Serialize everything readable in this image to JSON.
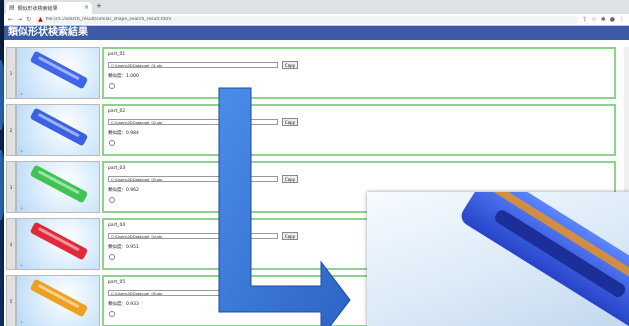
{
  "browser": {
    "tab_title": "類似形状検索結果",
    "new_tab_symbol": "+",
    "address_text": "file:///C:/search_result/similar_shape_search_result.html",
    "warning_icon": "warning-icon"
  },
  "header": {
    "title": "類似形状検索結果"
  },
  "results": [
    {
      "index": "1",
      "name": "part_01",
      "path": "C:\\Users\\3DData\\part_01.stp",
      "copy_label": "Copy",
      "similarity": "類似度：1.000",
      "color": "#3f66e8"
    },
    {
      "index": "2",
      "name": "part_02",
      "path": "C:\\Users\\3DData\\part_02.stp",
      "copy_label": "Copy",
      "similarity": "類似度：0.984",
      "color": "#3b61e2"
    },
    {
      "index": "3",
      "name": "part_03",
      "path": "C:\\Users\\3DData\\part_03.stp",
      "copy_label": "Copy",
      "similarity": "類似度：0.962",
      "color": "#3fc454"
    },
    {
      "index": "4",
      "name": "part_04",
      "path": "C:\\Users\\3DData\\part_04.stp",
      "copy_label": "Copy",
      "similarity": "類似度：0.951",
      "color": "#e02a3a"
    },
    {
      "index": "5",
      "name": "part_05",
      "path": "C:\\Users\\3DData\\part_05.stp",
      "copy_label": "Copy",
      "similarity": "類似度：0.933",
      "color": "#f0a020"
    }
  ]
}
